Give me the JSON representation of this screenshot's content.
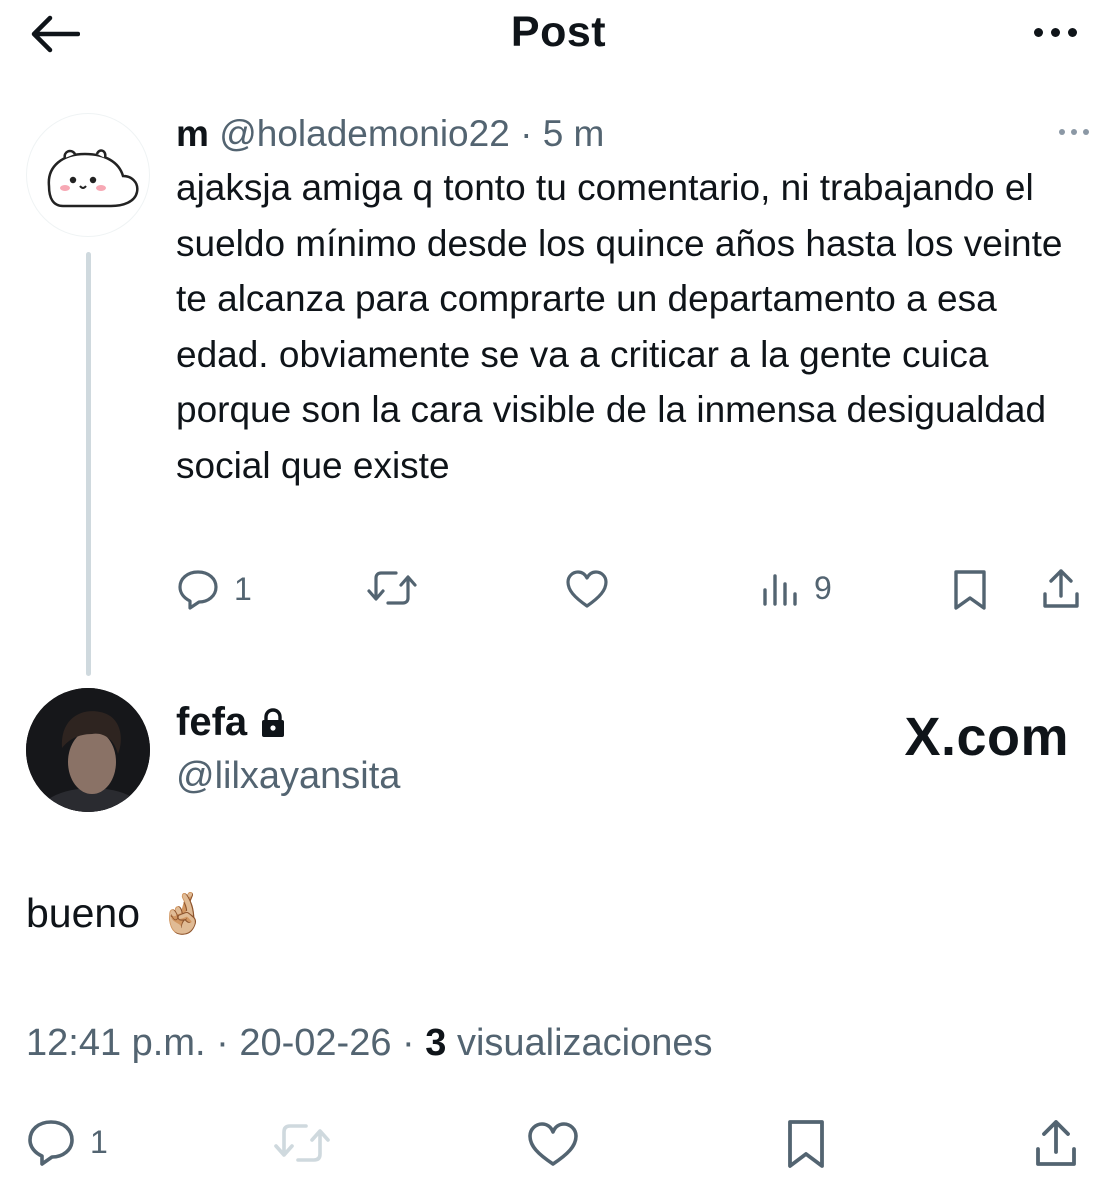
{
  "header": {
    "title": "Post"
  },
  "reply": {
    "name": "m",
    "handle": "@holademonio22",
    "separator": "·",
    "time": "5 m",
    "text": "ajaksja amiga q tonto tu comentario, ni trabajando el sueldo mínimo desde los quince años hasta los veinte te alcanza para comprarte un departamento a esa edad. obviamente se va a criticar a la gente cuica porque son la cara visible de la inmensa desigualdad social que existe",
    "reply_count": "1",
    "views": "9",
    "icons": [
      "reply-icon",
      "retweet-icon",
      "like-icon",
      "views-icon",
      "bookmark-icon",
      "share-icon"
    ]
  },
  "main": {
    "name": "fefa",
    "handle": "@lilxayansita",
    "watermark": "X.com",
    "text": "bueno",
    "emoji": "🤞🏼",
    "time": "12:41 p.m.",
    "separator1": "·",
    "date": "20-02-26",
    "separator2": "·",
    "views_count": "3",
    "views_label": "visualizaciones",
    "reply_count": "1",
    "icons": [
      "reply-icon",
      "retweet-icon",
      "like-icon",
      "bookmark-icon",
      "share-icon"
    ]
  },
  "colors": {
    "text": "#0f1419",
    "secondary": "#536471",
    "line": "#cfd9de",
    "disabled": "#cfd9de"
  }
}
